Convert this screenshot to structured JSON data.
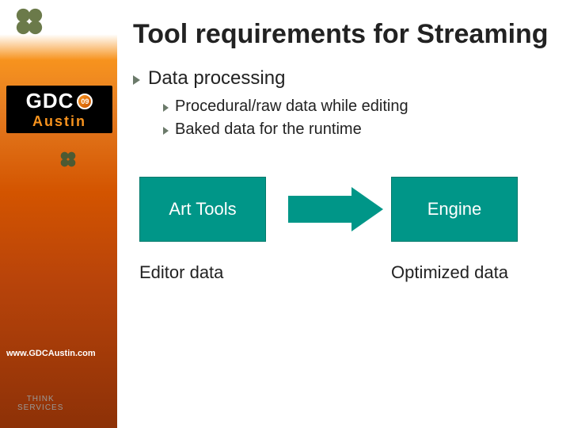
{
  "sidebar": {
    "gdc_text": "GDC",
    "gdc_year": "09",
    "gdc_city": "Austin",
    "url": "www.GDCAustin.com",
    "think_label_1": "THINK",
    "think_label_2": "SERVICES"
  },
  "title": "Tool requirements for Streaming",
  "bullets": {
    "l1": "Data processing",
    "l2a": "Procedural/raw data while editing",
    "l2b": "Baked data for the runtime"
  },
  "diagram": {
    "box_left": "Art Tools",
    "box_right": "Engine",
    "label_left": "Editor data",
    "label_right": "Optimized data"
  }
}
